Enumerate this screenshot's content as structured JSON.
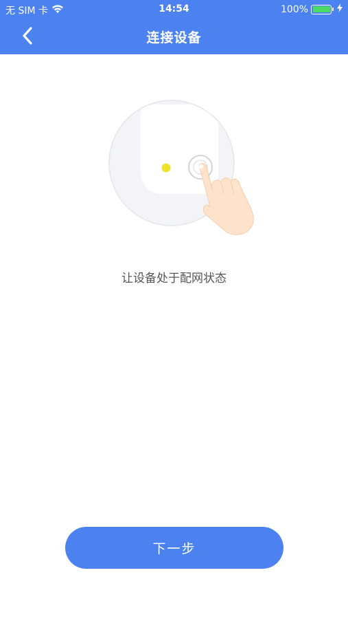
{
  "status_bar": {
    "carrier": "无 SIM 卡",
    "time": "14:54",
    "battery": "100%",
    "icons": [
      "wifi-icon",
      "battery-icon",
      "charging-bolt-icon"
    ]
  },
  "nav": {
    "title": "连接设备",
    "back_icon": "chevron-left-icon"
  },
  "illustration": {
    "description_icon": "finger-press-button-icon",
    "indicator_color": "#f0e12b"
  },
  "instruction": "让设备处于配网状态",
  "next_button": "下一步",
  "colors": {
    "accent": "#4c82ef",
    "text": "#555555",
    "background": "#ffffff"
  }
}
